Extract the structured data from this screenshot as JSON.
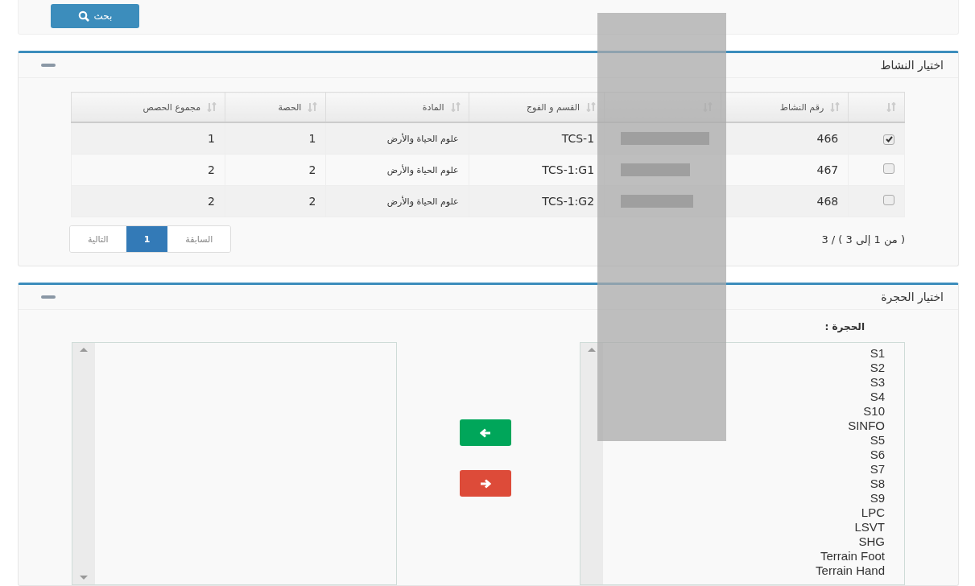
{
  "search_button": {
    "label": "بحث"
  },
  "activity_panel": {
    "title": "اختيار النشاط",
    "table": {
      "columns": [
        {
          "kind": "check"
        },
        {
          "kind": "text",
          "label": "رقم النشاط"
        },
        {
          "kind": "redacted"
        },
        {
          "kind": "text",
          "label": "القسم و الفوج"
        },
        {
          "kind": "text",
          "label": "المادة"
        },
        {
          "kind": "text",
          "label": "الحصة"
        },
        {
          "kind": "text",
          "label": "مجموع الحصص"
        }
      ],
      "rows": [
        {
          "checked": true,
          "cells": [
            "",
            "466",
            "",
            "TCS-1",
            "علوم الحياة والأرض",
            "1",
            "1"
          ]
        },
        {
          "checked": false,
          "cells": [
            "",
            "467",
            "",
            "TCS-1:G1",
            "علوم الحياة والأرض",
            "2",
            "2"
          ]
        },
        {
          "checked": false,
          "cells": [
            "",
            "468",
            "",
            "TCS-1:G2",
            "علوم الحياة والأرض",
            "2",
            "2"
          ]
        }
      ]
    },
    "info": "( من 1 إلى 3 ) / 3",
    "pagination": [
      {
        "label": "السابقة",
        "selected": false
      },
      {
        "label": "1",
        "selected": true
      },
      {
        "label": "التالية",
        "selected": false
      }
    ]
  },
  "room_panel": {
    "title": "اختيار الحجرة",
    "field_label": "الحجرة :",
    "rooms": [
      "S1",
      "S2",
      "S3",
      "S4",
      "S10",
      "SINFO",
      "S5",
      "S6",
      "S7",
      "S8",
      "S9",
      "LPC",
      "LSVT",
      "SHG",
      "Terrain Foot",
      "Terrain Hand"
    ]
  }
}
